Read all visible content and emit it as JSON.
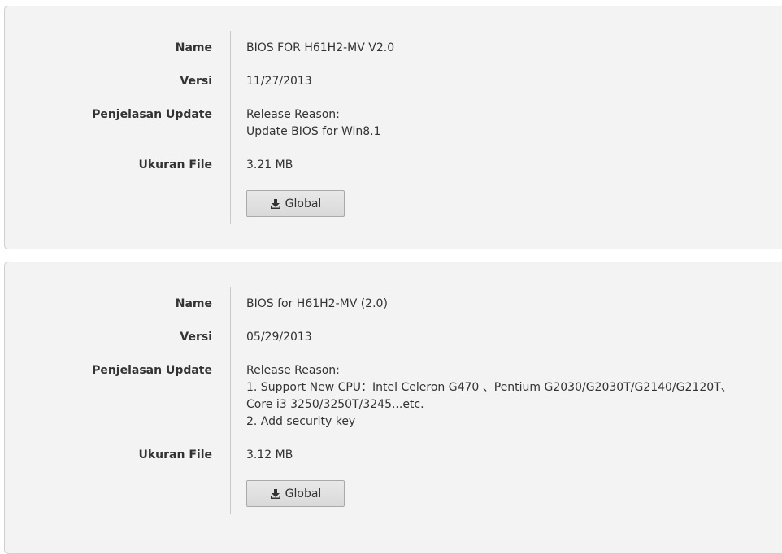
{
  "entries": [
    {
      "name_label": "Name",
      "name": "BIOS FOR H61H2-MV V2.0",
      "version_label": "Versi",
      "version": "11/27/2013",
      "update_label": "Penjelasan Update",
      "update_description": "Release Reason:\nUpdate BIOS for Win8.1",
      "size_label": "Ukuran File",
      "size": "3.21 MB",
      "download_label": "Global",
      "download_icon": "download-icon"
    },
    {
      "name_label": "Name",
      "name": "BIOS for H61H2-MV (2.0)",
      "version_label": "Versi",
      "version": "05/29/2013",
      "update_label": "Penjelasan Update",
      "update_description": "Release Reason:\n1. Support New CPU：Intel Celeron G470 、Pentium G2030/G2030T/G2140/G2120T、Core i3 3250/3250T/3245...etc.\n2. Add security key",
      "size_label": "Ukuran File",
      "size": "3.12 MB",
      "download_label": "Global",
      "download_icon": "download-icon"
    }
  ],
  "colors": {
    "card_background": "#f3f3f3",
    "card_border": "#cfcfcf",
    "text": "#333333"
  }
}
